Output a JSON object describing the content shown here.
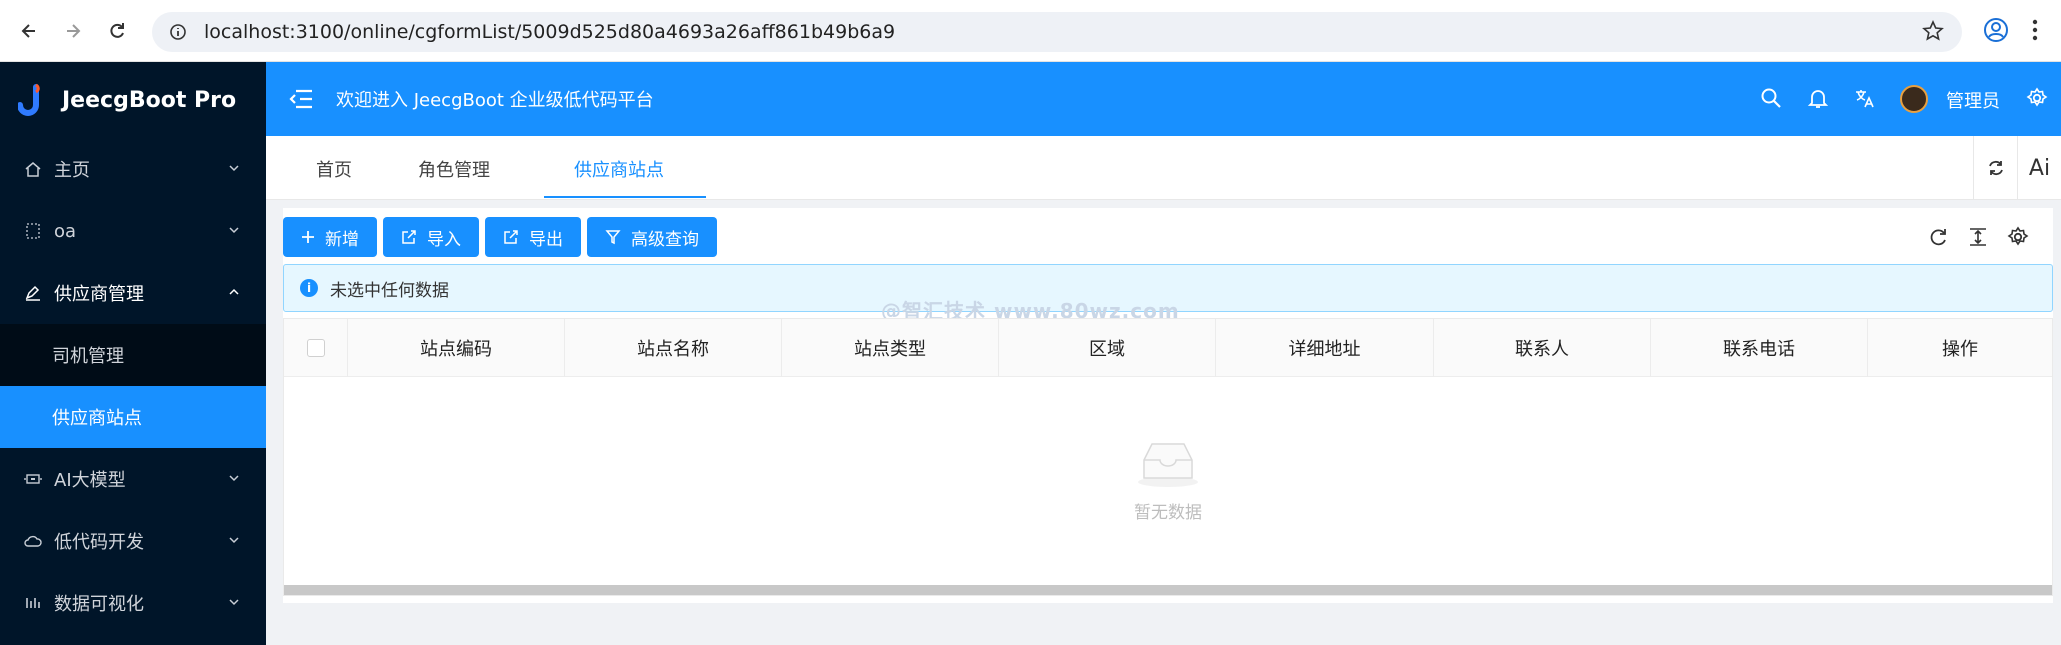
{
  "browser": {
    "url": "localhost:3100/online/cgformList/5009d525d80a4693a26aff861b49b6a9"
  },
  "sidebar": {
    "logo_text": "JeecgBoot Pro",
    "items": [
      {
        "label": "主页",
        "icon": "home-icon"
      },
      {
        "label": "oa",
        "icon": "grid-icon"
      },
      {
        "label": "供应商管理",
        "icon": "edit-icon",
        "open": true,
        "children": [
          {
            "label": "司机管理"
          },
          {
            "label": "供应商站点",
            "active": true
          }
        ]
      },
      {
        "label": "AI大模型",
        "icon": "ai-icon"
      },
      {
        "label": "低代码开发",
        "icon": "cloud-icon"
      },
      {
        "label": "数据可视化",
        "icon": "chart-icon"
      }
    ]
  },
  "header": {
    "welcome": "欢迎进入 JeecgBoot 企业级低代码平台",
    "user": "管理员"
  },
  "tabs": [
    {
      "label": "首页"
    },
    {
      "label": "角色管理"
    },
    {
      "label": "供应商站点",
      "active": true
    }
  ],
  "tab_tools": {
    "ai_label": "Ai"
  },
  "toolbar": {
    "add_label": "新增",
    "import_label": "导入",
    "export_label": "导出",
    "query_label": "高级查询"
  },
  "alert": {
    "text": "未选中任何数据"
  },
  "watermark": "@智汇技术 www.80wz.com",
  "table": {
    "columns": [
      "站点编码",
      "站点名称",
      "站点类型",
      "区域",
      "详细地址",
      "联系人",
      "联系电话",
      "操作"
    ],
    "rows": [],
    "empty_text": "暂无数据"
  },
  "colors": {
    "primary": "#1890ff",
    "sidebar": "#001529"
  }
}
